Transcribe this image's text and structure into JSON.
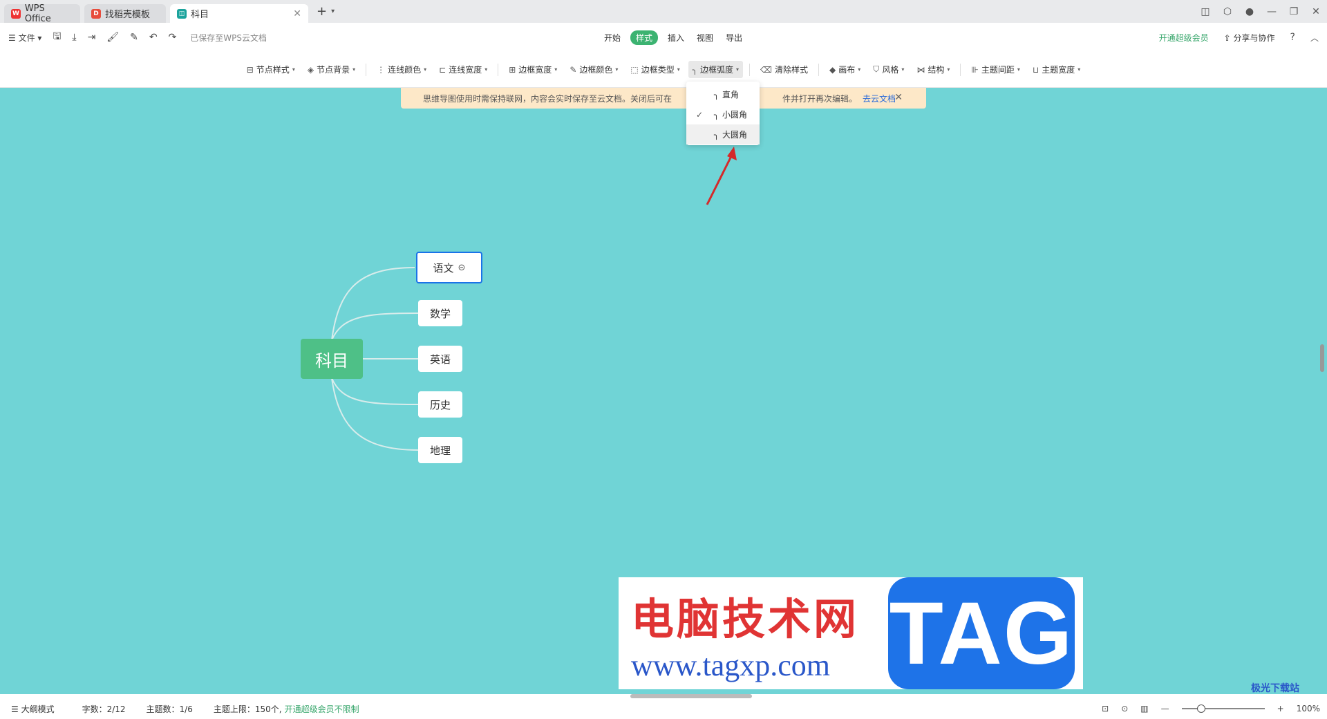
{
  "tabs": [
    {
      "label": "WPS Office",
      "icon": "wps-logo-icon"
    },
    {
      "label": "找稻壳模板",
      "icon": "docer-icon"
    },
    {
      "label": "科目",
      "icon": "mindmap-icon"
    }
  ],
  "toolbar": {
    "file": "文件",
    "saved": "已保存至WPS云文档",
    "menus": [
      "开始",
      "样式",
      "插入",
      "视图",
      "导出"
    ],
    "active_menu": "样式",
    "vip": "开通超级会员",
    "share": "分享与协作"
  },
  "style_tools": [
    {
      "label": "节点样式",
      "icon": "node-style-icon"
    },
    {
      "label": "节点背景",
      "icon": "fill-icon"
    },
    {
      "label": "连线颜色",
      "icon": "line-color-icon"
    },
    {
      "label": "连线宽度",
      "icon": "line-width-icon"
    },
    {
      "label": "边框宽度",
      "icon": "border-width-icon"
    },
    {
      "label": "边框颜色",
      "icon": "pen-icon"
    },
    {
      "label": "边框类型",
      "icon": "dashed-border-icon"
    },
    {
      "label": "边框弧度",
      "icon": "corner-icon"
    },
    {
      "label": "清除样式",
      "icon": "eraser-icon"
    },
    {
      "label": "画布",
      "icon": "canvas-icon"
    },
    {
      "label": "风格",
      "icon": "shirt-icon"
    },
    {
      "label": "结构",
      "icon": "structure-icon"
    },
    {
      "label": "主题间距",
      "icon": "spacing-icon"
    },
    {
      "label": "主题宽度",
      "icon": "width-icon"
    }
  ],
  "notice": {
    "text": "思维导图使用时需保持联网，内容会实时保存至云文档。关闭后可在",
    "text2": "件并打开再次编辑。",
    "link": "去云文档"
  },
  "dropdown": {
    "items": [
      {
        "label": "直角",
        "checked": false
      },
      {
        "label": "小圆角",
        "checked": true
      },
      {
        "label": "大圆角",
        "checked": false
      }
    ]
  },
  "mindmap": {
    "root": "科目",
    "children": [
      "语文",
      "数学",
      "英语",
      "历史",
      "地理"
    ]
  },
  "watermark": {
    "cn": "电脑技术网",
    "url": "www.tagxp.com",
    "tag": "TAG",
    "corner": "极光下载站"
  },
  "status": {
    "outline": "大纲模式",
    "words": "字数：2/12",
    "topics": "主题数：1/6",
    "limit": "主题上限：150个,",
    "vip": "开通超级会员不限制",
    "zoom": "100%"
  },
  "colors": {
    "canvas": "#70d4d6",
    "root": "#4ec087",
    "accent": "#3cb371"
  }
}
